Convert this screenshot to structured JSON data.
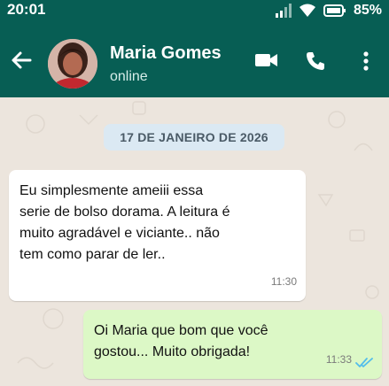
{
  "status_bar": {
    "time": "20:01",
    "battery_percent": "85%",
    "icons": [
      "signal-icon",
      "wifi-icon",
      "battery-icon"
    ]
  },
  "header": {
    "contact_name": "Maria Gomes",
    "contact_status": "online",
    "actions": [
      "video-call-icon",
      "voice-call-icon",
      "more-options-icon"
    ]
  },
  "chat": {
    "date_chip": "17 DE JANEIRO DE 2026",
    "messages": [
      {
        "direction": "incoming",
        "text": "Eu simplesmente ameiii essa serie de bolso dorama. A leitura é muito agradável e viciante.. não tem como parar de ler..",
        "time": "11:30"
      },
      {
        "direction": "outgoing",
        "text": "Oi Maria que bom que você gostou... Muito obrigada!",
        "time": "11:33",
        "status": "read"
      }
    ]
  },
  "colors": {
    "header_bg": "#075e54",
    "chat_bg": "#ece5dd",
    "incoming_bubble": "#ffffff",
    "outgoing_bubble": "#dcf8c6",
    "read_ticks": "#53bdeb",
    "date_chip_bg": "#dbe9f3"
  }
}
